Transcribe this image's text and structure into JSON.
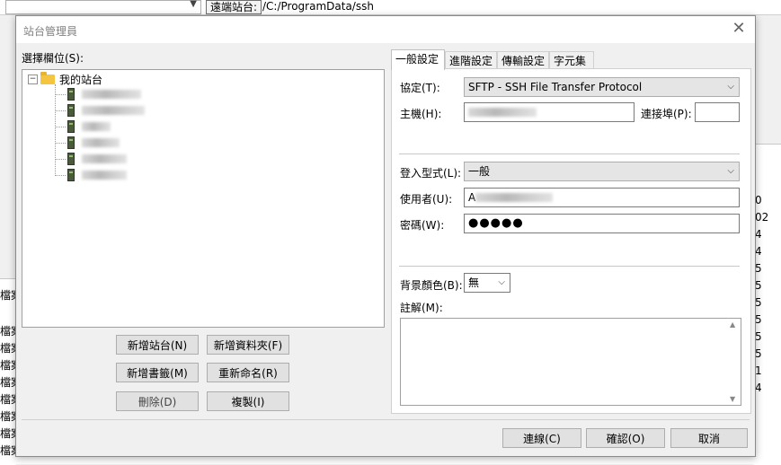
{
  "background": {
    "remote_site_label": "遠端站台:",
    "remote_path": "/C:/ProgramData/ssh",
    "right_numbers": [
      "0",
      "02",
      "4",
      "4",
      "5",
      "5",
      "5",
      "5",
      "5",
      "5",
      "1",
      "4"
    ],
    "left_fragments": [
      "檔案",
      "檔案",
      "檔案",
      "檔案",
      "檔案",
      "檔案",
      "檔案",
      "檔案",
      "檔案",
      "檔案"
    ]
  },
  "dialog": {
    "title": "站台管理員",
    "select_entry_label": "選擇欄位(S):",
    "tree": {
      "root_label": "我的站台",
      "root_expander": "−"
    },
    "buttons": {
      "new_site": "新增站台(N)",
      "new_folder": "新增資料夾(F)",
      "new_bookmark": "新增書籤(M)",
      "rename": "重新命名(R)",
      "delete": "刪除(D)",
      "duplicate": "複製(I)",
      "connect": "連線(C)",
      "ok": "確認(O)",
      "cancel": "取消"
    },
    "tabs": [
      "一般設定",
      "進階設定",
      "傳輸設定",
      "字元集"
    ],
    "general": {
      "protocol_label": "協定(T):",
      "protocol_value": "SFTP - SSH File Transfer Protocol",
      "host_label": "主機(H):",
      "port_label": "連接埠(P):",
      "port_value": "",
      "logon_type_label": "登入型式(L):",
      "logon_type_value": "一般",
      "user_label": "使用者(U):",
      "user_prefix": "A",
      "password_label": "密碼(W):",
      "password_value": "●●●●●",
      "bg_color_label": "背景顏色(B):",
      "bg_color_value": "無",
      "comments_label": "註解(M):",
      "comments_value": ""
    }
  },
  "icons": {
    "close": "close-icon",
    "chevron": "chevron-down-icon",
    "folder": "folder-icon",
    "server": "server-icon"
  }
}
